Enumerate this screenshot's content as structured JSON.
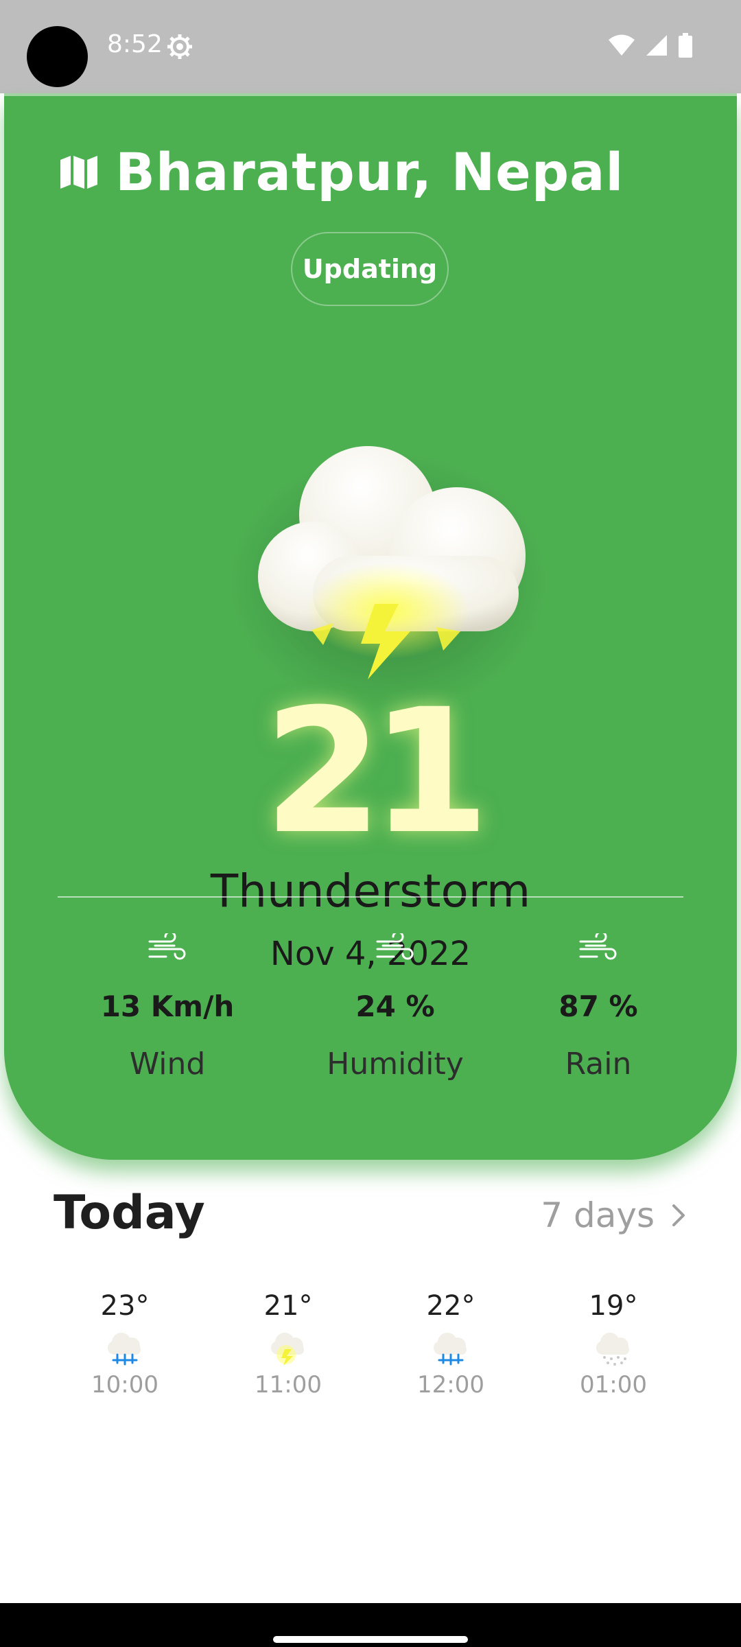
{
  "status_bar": {
    "time": "8:52",
    "icons": [
      "gear-icon",
      "wifi-icon",
      "signal-icon",
      "battery-icon"
    ]
  },
  "location": {
    "icon": "map-icon",
    "name": "Bharatpur, Nepal"
  },
  "status_pill": "Updating",
  "current": {
    "temperature": "21",
    "condition": "Thunderstorm",
    "date": "Nov 4, 2022",
    "icon": "cloud-lightning-icon"
  },
  "stats": [
    {
      "icon": "wind-icon",
      "value": "13 Km/h",
      "label": "Wind"
    },
    {
      "icon": "wind-icon",
      "value": "24 %",
      "label": "Humidity"
    },
    {
      "icon": "wind-icon",
      "value": "87 %",
      "label": "Rain"
    }
  ],
  "today": {
    "title": "Today",
    "more_label": "7 days",
    "hours": [
      {
        "temp": "23°",
        "time": "10:00",
        "icon": "rain-cloud-icon"
      },
      {
        "temp": "21°",
        "time": "11:00",
        "icon": "storm-cloud-icon"
      },
      {
        "temp": "22°",
        "time": "12:00",
        "icon": "rain-cloud-icon"
      },
      {
        "temp": "19°",
        "time": "01:00",
        "icon": "snow-cloud-icon"
      }
    ]
  },
  "colors": {
    "card_green": "#4caf50",
    "lightning_yellow": "#f5f23a",
    "rain_blue": "#1e88e5"
  }
}
